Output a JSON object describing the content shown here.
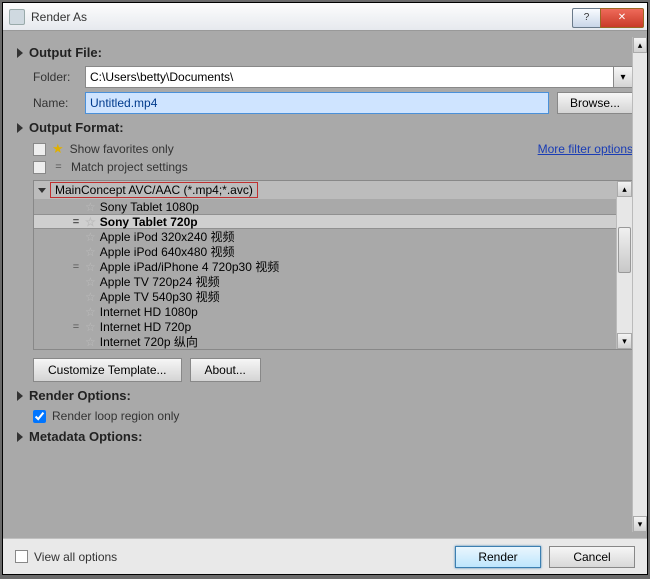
{
  "window": {
    "title": "Render As"
  },
  "output_file": {
    "title": "Output File:",
    "folder_label": "Folder:",
    "folder_value": "C:\\Users\\betty\\Documents\\",
    "name_label": "Name:",
    "name_value": "Untitled.mp4",
    "browse": "Browse..."
  },
  "output_format": {
    "title": "Output Format:",
    "fav_label": "Show favorites only",
    "match_label": "Match project settings",
    "more_filter": "More filter options",
    "codec": "MainConcept AVC/AAC (*.mp4;*.avc)",
    "presets": [
      {
        "label": "Sony Tablet 1080p",
        "eq": false,
        "selected": false
      },
      {
        "label": "Sony Tablet 720p",
        "eq": true,
        "selected": true
      },
      {
        "label": "Apple iPod 320x240 视频",
        "eq": false,
        "selected": false
      },
      {
        "label": "Apple iPod 640x480 视频",
        "eq": false,
        "selected": false
      },
      {
        "label": "Apple iPad/iPhone 4 720p30 视频",
        "eq": true,
        "selected": false
      },
      {
        "label": "Apple TV 720p24 视频",
        "eq": false,
        "selected": false
      },
      {
        "label": "Apple TV 540p30 视频",
        "eq": false,
        "selected": false
      },
      {
        "label": "Internet HD 1080p",
        "eq": false,
        "selected": false
      },
      {
        "label": "Internet HD 720p",
        "eq": true,
        "selected": false
      },
      {
        "label": "Internet 720p 纵向",
        "eq": false,
        "selected": false
      }
    ],
    "customize": "Customize Template...",
    "about": "About..."
  },
  "render_options": {
    "title": "Render Options:",
    "loop_label": "Render loop region only",
    "loop_checked": true
  },
  "metadata_options": {
    "title": "Metadata Options:"
  },
  "footer": {
    "view_all": "View all options",
    "render": "Render",
    "cancel": "Cancel"
  }
}
